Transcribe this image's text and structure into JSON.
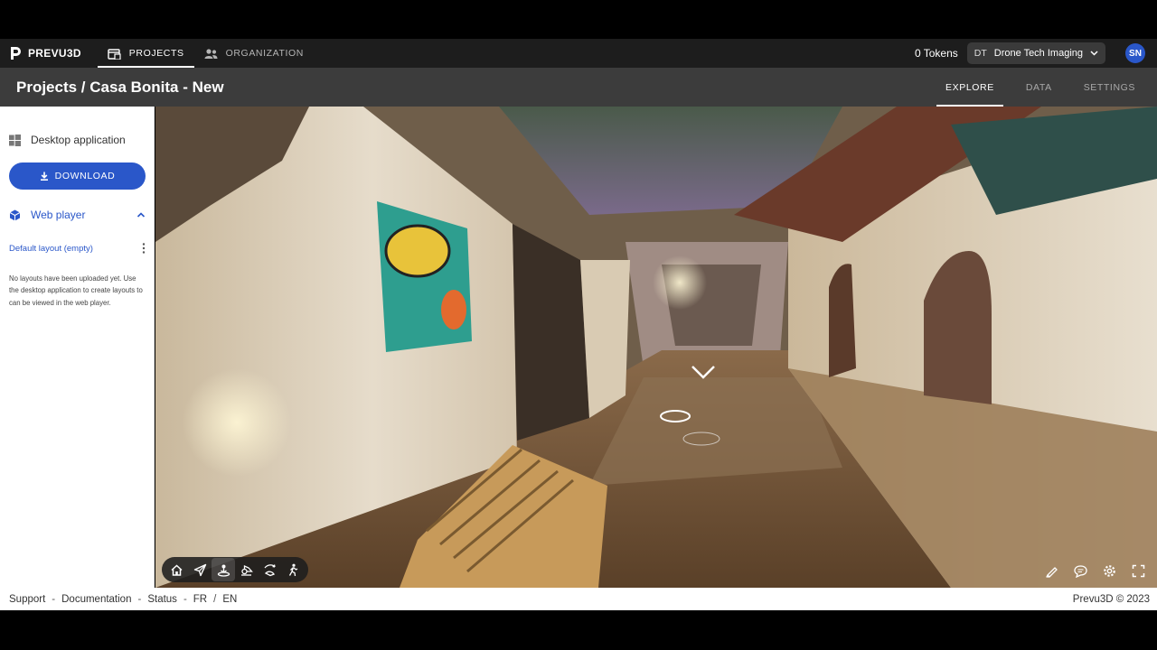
{
  "app": {
    "brand": "PREVU3D"
  },
  "nav": {
    "tabs": [
      {
        "label": "PROJECTS",
        "icon": "projects-icon",
        "active": true
      },
      {
        "label": "ORGANIZATION",
        "icon": "organization-icon",
        "active": false
      }
    ],
    "tokens": "0 Tokens",
    "org": {
      "initials": "DT",
      "name": "Drone Tech Imaging"
    },
    "user_initials": "SN"
  },
  "header": {
    "title": "Projects / Casa Bonita - New",
    "tabs": [
      {
        "label": "EXPLORE",
        "active": true
      },
      {
        "label": "DATA",
        "active": false
      },
      {
        "label": "SETTINGS",
        "active": false
      }
    ]
  },
  "sidebar": {
    "desktop_label": "Desktop application",
    "download_label": "DOWNLOAD",
    "webplayer_label": "Web player",
    "layout_label": "Default layout (empty)",
    "info_text": "No layouts have been uploaded yet. Use the desktop application to create layouts to can be viewed in the web player."
  },
  "viewer": {
    "toolbar_left": [
      "home-icon",
      "fly-icon",
      "orbit-icon",
      "drone-icon",
      "swipe-icon",
      "walk-icon"
    ],
    "active_tool": "orbit-icon",
    "toolbar_right": [
      "measure-icon",
      "comment-icon",
      "settings-icon",
      "fullscreen-icon"
    ]
  },
  "footer": {
    "links": [
      "Support",
      "Documentation",
      "Status",
      "FR",
      "EN"
    ],
    "copyright": "Prevu3D © 2023"
  },
  "colors": {
    "accent": "#2a57c9",
    "topbar": "#1d1d1d",
    "subbar": "#3c3c3c"
  }
}
